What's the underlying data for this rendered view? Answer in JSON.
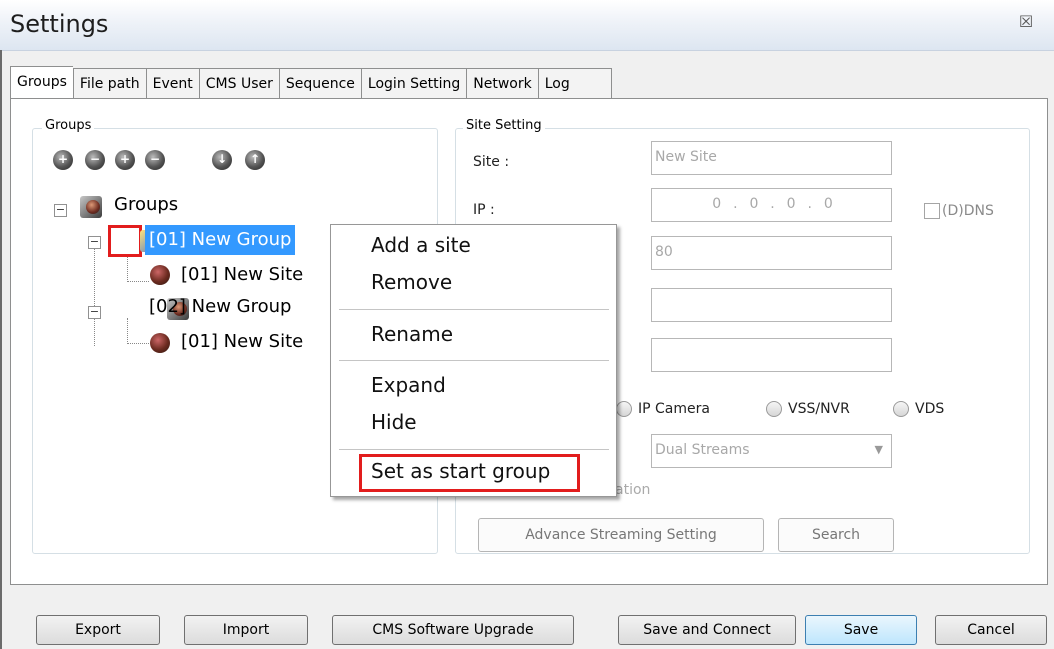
{
  "window": {
    "title": "Settings",
    "close_glyph": "☒"
  },
  "tabs": [
    "Groups",
    "File path",
    "Event",
    "CMS User",
    "Sequence",
    "Login Setting",
    "Network",
    "Log"
  ],
  "groups_box": {
    "title": "Groups",
    "toolbar_icons": [
      "add-group-icon",
      "remove-group-icon",
      "add-site-icon",
      "remove-site-icon",
      "import-site-icon",
      "export-site-icon"
    ],
    "tree": {
      "root": "Groups",
      "group1": "[01] New Group",
      "group1_site": "[01] New Site",
      "group2": "[02] New Group",
      "group2_site": "[01] New Site"
    }
  },
  "site_setting": {
    "title": "Site Setting",
    "site_label": "Site :",
    "site_value": "New Site",
    "ip_label": "IP :",
    "ip_octets": [
      "0",
      "0",
      "0",
      "0"
    ],
    "ip_dot": ".",
    "ddns_label": "(D)DNS",
    "port_value": "80",
    "radio_ipcam": "IP Camera",
    "radio_vss": "VSS/NVR",
    "radio_vds": "VDS",
    "stream_select": "Dual Streams",
    "partial_text": "ation",
    "advance_button": "Advance Streaming Setting",
    "search_button": "Search"
  },
  "context_menu": {
    "items": [
      "Add a site",
      "Remove",
      "Rename",
      "Expand",
      "Hide",
      "Set as start group"
    ]
  },
  "bottom_buttons": {
    "export": "Export",
    "import": "Import",
    "upgrade": "CMS Software Upgrade",
    "save_connect": "Save and Connect",
    "save": "Save",
    "cancel": "Cancel"
  }
}
